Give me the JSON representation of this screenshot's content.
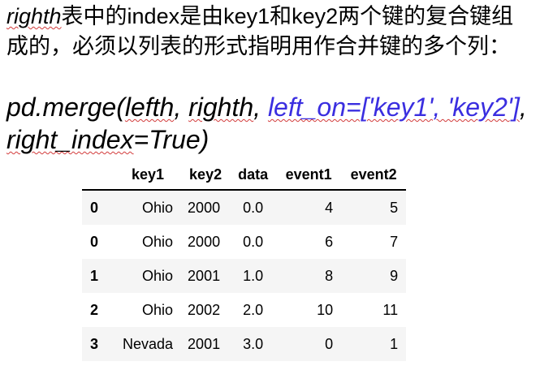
{
  "paragraph": {
    "word1": "righth",
    "text1": "表中的index是由key1和key2两个键的复合键组成的，必须以列表的形式指明用作合并键的多个列："
  },
  "code": {
    "p1": "pd.merge(",
    "p2": "lefth",
    "p3": ", ",
    "p4": "righth",
    "p5": ", ",
    "p6": "left_on=['key1', 'key2']",
    "p7": ", ",
    "p8": "right_index",
    "p9": "=True)"
  },
  "table": {
    "columns": [
      "",
      "key1",
      "key2",
      "data",
      "event1",
      "event2"
    ],
    "rows": [
      {
        "index": "0",
        "key1": "Ohio",
        "key2": "2000",
        "data": "0.0",
        "event1": "4",
        "event2": "5"
      },
      {
        "index": "0",
        "key1": "Ohio",
        "key2": "2000",
        "data": "0.0",
        "event1": "6",
        "event2": "7"
      },
      {
        "index": "1",
        "key1": "Ohio",
        "key2": "2001",
        "data": "1.0",
        "event1": "8",
        "event2": "9"
      },
      {
        "index": "2",
        "key1": "Ohio",
        "key2": "2002",
        "data": "2.0",
        "event1": "10",
        "event2": "11"
      },
      {
        "index": "3",
        "key1": "Nevada",
        "key2": "2001",
        "data": "3.0",
        "event1": "0",
        "event2": "1"
      }
    ]
  }
}
